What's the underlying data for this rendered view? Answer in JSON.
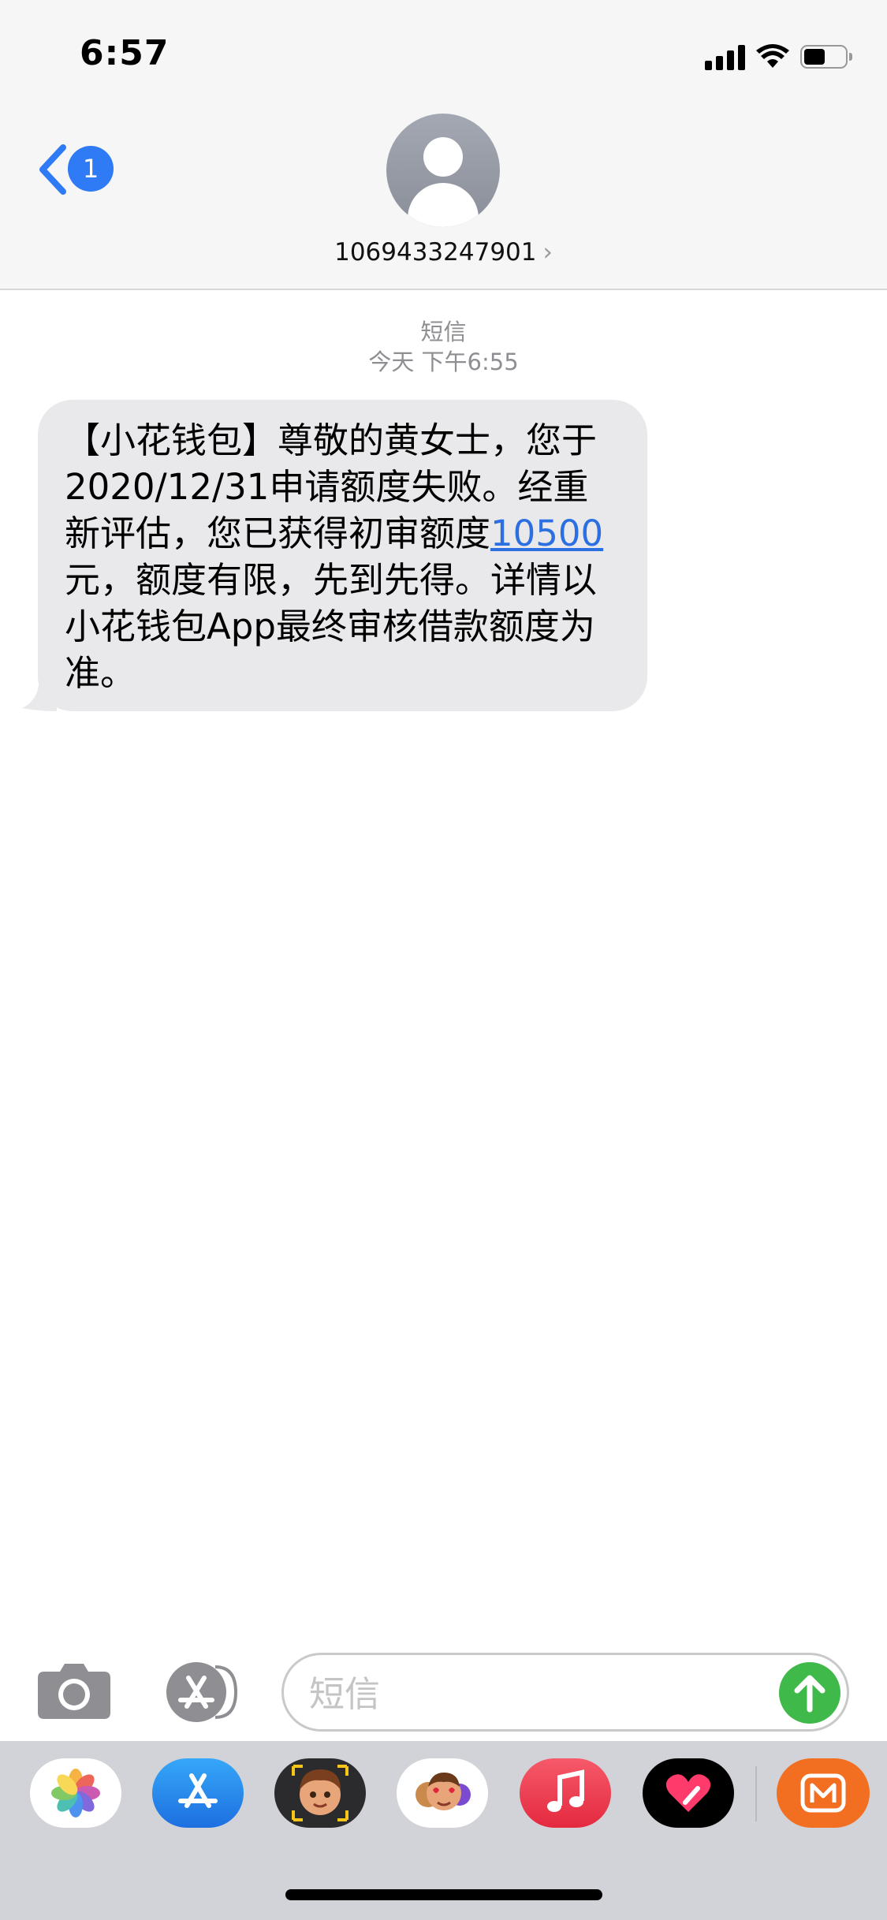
{
  "status_bar": {
    "time": "6:57"
  },
  "nav": {
    "back_badge": "1",
    "contact_number": "1069433247901",
    "contact_chevron": "›"
  },
  "thread": {
    "service_label": "短信",
    "timestamp": "今天 下午6:55"
  },
  "message": {
    "before_link": "【小花钱包】尊敬的黄女士，您于2020/12/31申请额度失败。经重新评估，您已获得初审额度",
    "link": "10500",
    "after_link": "元，额度有限，先到先得。详情以小花钱包App最终审核借款额度为准。"
  },
  "composer": {
    "placeholder": "短信"
  },
  "app_drawer": [
    {
      "name": "Photos",
      "icon": "photos-icon"
    },
    {
      "name": "App Store",
      "icon": "appstore-icon"
    },
    {
      "name": "Memoji",
      "icon": "memoji-icon"
    },
    {
      "name": "Memoji Stickers",
      "icon": "memoji-stickers-icon"
    },
    {
      "name": "Music",
      "icon": "music-icon"
    },
    {
      "name": "Digital Touch",
      "icon": "digital-touch-icon"
    },
    {
      "name": "Mango TV",
      "icon": "mango-tv-icon"
    }
  ],
  "colors": {
    "accent_blue": "#2f7bf5",
    "bubble_gray": "#e9e9eb",
    "send_green": "#3fba4a",
    "drawer_bg": "#d1d3d8"
  }
}
